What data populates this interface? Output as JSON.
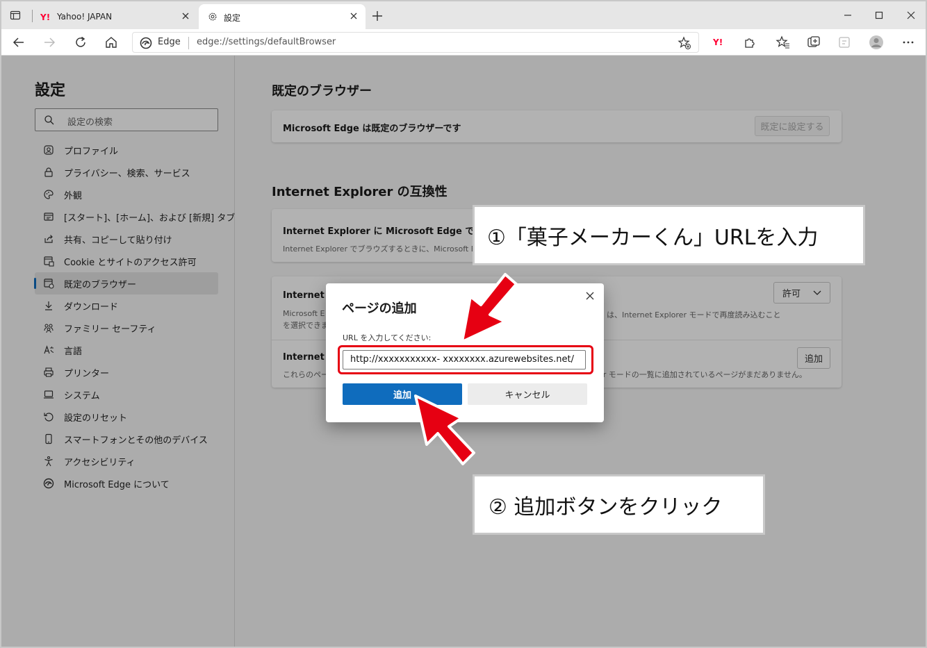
{
  "tabs": [
    {
      "title": "Yahoo! JAPAN",
      "favicon": "yahoo-icon"
    },
    {
      "title": "設定",
      "favicon": "gear-icon"
    }
  ],
  "address": {
    "site_label": "Edge",
    "url": "edge://settings/defaultBrowser"
  },
  "sidebar": {
    "title": "設定",
    "search_placeholder": "設定の検索",
    "items": [
      {
        "label": "プロファイル",
        "icon": "profile-icon"
      },
      {
        "label": "プライバシー、検索、サービス",
        "icon": "lock-icon"
      },
      {
        "label": "外観",
        "icon": "palette-icon"
      },
      {
        "label": "[スタート]、[ホーム]、および [新規] タブ",
        "icon": "home-tab-icon"
      },
      {
        "label": "共有、コピーして貼り付け",
        "icon": "share-icon"
      },
      {
        "label": "Cookie とサイトのアクセス許可",
        "icon": "site-permissions-icon"
      },
      {
        "label": "既定のブラウザー",
        "icon": "default-browser-icon",
        "selected": true
      },
      {
        "label": "ダウンロード",
        "icon": "download-icon"
      },
      {
        "label": "ファミリー セーフティ",
        "icon": "family-icon"
      },
      {
        "label": "言語",
        "icon": "language-icon"
      },
      {
        "label": "プリンター",
        "icon": "printer-icon"
      },
      {
        "label": "システム",
        "icon": "system-icon"
      },
      {
        "label": "設定のリセット",
        "icon": "reset-icon"
      },
      {
        "label": "スマートフォンとその他のデバイス",
        "icon": "phone-icon"
      },
      {
        "label": "アクセシビリティ",
        "icon": "accessibility-icon"
      },
      {
        "label": "Microsoft Edge について",
        "icon": "edge-icon"
      }
    ]
  },
  "main": {
    "section1_title": "既定のブラウザー",
    "default_card_text": "Microsoft Edge は既定のブラウザーです",
    "set_default_button": "既定に設定する",
    "section2_title": "Internet Explorer の互換性",
    "ie_card1_title": "Internet Explorer に Microsoft Edge でサイトを",
    "ie_card1_desc": "Internet Explorer でブラウズするときに、Microsoft Edge",
    "ie_card2_title": "Internet E",
    "ie_card2_desc1": "Microsoft E",
    "ie_card2_desc1_right": "は、Internet Explorer モードで再度読み込むこと",
    "ie_card2_desc2": "を選択できま",
    "allow_dropdown": "許可",
    "ie_card3_title": "Internet E",
    "ie_card3_desc": "これらのペー",
    "ie_card3_desc_right": "er モードの一覧に追加されているページがまだありません。",
    "add_button": "追加"
  },
  "dialog": {
    "title": "ページの追加",
    "label": "URL を入力してください:",
    "input_value": "http://xxxxxxxxxxx- xxxxxxxx.azurewebsites.net/",
    "add_button": "追加",
    "cancel_button": "キャンセル"
  },
  "callouts": {
    "step1": "①「菓子メーカーくん」URLを入力",
    "step2": "② 追加ボタンをクリック"
  },
  "colors": {
    "accent": "#0f6cbd",
    "highlight": "#e60012"
  }
}
